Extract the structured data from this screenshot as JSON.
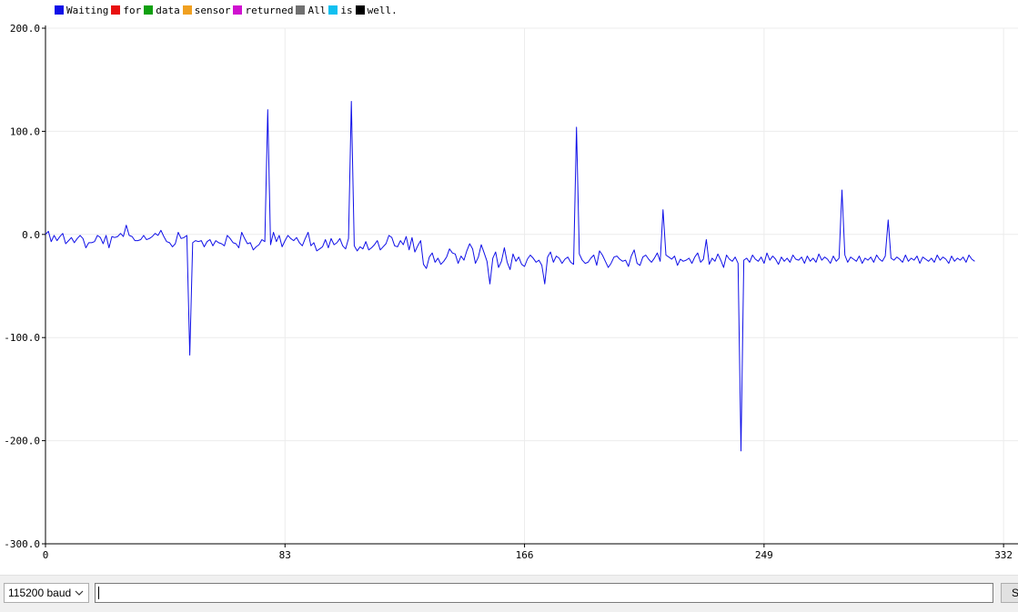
{
  "legend": [
    {
      "label": "Waiting",
      "color": "#1010e8"
    },
    {
      "label": "for",
      "color": "#e81010"
    },
    {
      "label": "data",
      "color": "#10a010"
    },
    {
      "label": "sensor",
      "color": "#f0a020"
    },
    {
      "label": "returned",
      "color": "#d010d0"
    },
    {
      "label": "All",
      "color": "#707070"
    },
    {
      "label": "is",
      "color": "#10c0f0"
    },
    {
      "label": "well.",
      "color": "#000000"
    }
  ],
  "chart_data": {
    "type": "line",
    "ylim": [
      -300,
      200
    ],
    "xlim": [
      0,
      337
    ],
    "yticks": [
      "200.0",
      "100.0",
      "0.0",
      "-100.0",
      "-200.0",
      "-300.0"
    ],
    "xticks": [
      "0",
      "83",
      "166",
      "249",
      "332"
    ],
    "grid": true,
    "series": [
      {
        "color": "#1010e8",
        "values": [
          0,
          3,
          -7,
          -1,
          -6,
          -2,
          1,
          -9,
          -6,
          -3,
          -8,
          -4,
          -1,
          -4,
          -13,
          -8,
          -8,
          -7,
          -1,
          -3,
          -9,
          -1,
          -13,
          -2,
          -3,
          -2,
          1,
          -2,
          9,
          -1,
          -2,
          -6,
          -6,
          -5,
          -1,
          -5,
          -4,
          -2,
          1,
          -1,
          4,
          -2,
          -7,
          -8,
          -12,
          -9,
          2,
          -4,
          -3,
          -1,
          -117,
          -8,
          -6,
          -7,
          -6,
          -12,
          -7,
          -5,
          -11,
          -6,
          -8,
          -9,
          -11,
          -1,
          -4,
          -8,
          -9,
          -13,
          2,
          -4,
          -9,
          -8,
          -15,
          -12,
          -10,
          -5,
          -7,
          -4,
          -10,
          2,
          -7,
          -1,
          -12,
          -6,
          -1,
          -4,
          -6,
          -3,
          -8,
          -11,
          -4,
          2,
          -11,
          -8,
          -16,
          -14,
          -12,
          -5,
          -13,
          -4,
          -10,
          -8,
          -4,
          -11,
          -14,
          -4,
          -9,
          -11,
          -16,
          -12,
          -14,
          -7,
          -15,
          -13,
          -10,
          -6,
          -15,
          -12,
          -9,
          -1,
          -3,
          -11,
          -12,
          -6,
          -10,
          -2,
          -15,
          -3,
          -17,
          -11,
          -6,
          -29,
          -33,
          -22,
          -18,
          -27,
          -23,
          -29,
          -26,
          -22,
          -14,
          -18,
          -19,
          -28,
          -21,
          -25,
          -16,
          -9,
          -14,
          -28,
          -22,
          -10,
          -18,
          -26,
          -20,
          -23,
          -17,
          -32,
          -26,
          -13,
          -27,
          -34,
          -19,
          -26,
          -22,
          -29,
          -31,
          -24,
          -20,
          -23,
          -27,
          -25,
          -30,
          -48,
          -22,
          -17,
          -27,
          -21,
          -23,
          -28,
          -24,
          -22,
          -27,
          -29,
          -26,
          -19,
          -25,
          -28,
          -27,
          -23,
          -20,
          -30,
          -16,
          -20,
          -26,
          -32,
          -28,
          -22,
          -21,
          -24,
          -26,
          -25,
          -31,
          -21,
          -15,
          -28,
          -30,
          -22,
          -20,
          -24,
          -27,
          -23,
          -18,
          -26,
          -27,
          -20,
          -22,
          -24,
          -21,
          -30,
          -24,
          -26,
          -25,
          -23,
          -28,
          -22,
          -18,
          -27,
          -24,
          -21,
          -29,
          -23,
          -26,
          -19,
          -25,
          -32,
          -20,
          -24,
          -26,
          -22,
          -28,
          -21,
          -25,
          -23,
          -27,
          -20,
          -24,
          -26,
          -22,
          -28,
          -18,
          -25,
          -21,
          -24,
          -29,
          -22,
          -26,
          -23,
          -27,
          -20,
          -24,
          -25,
          -22,
          -28,
          -21,
          -26,
          -23,
          -27,
          -19,
          -25,
          -22,
          -24,
          -28,
          -21,
          -26,
          -23,
          -25,
          -20,
          -27,
          -22,
          -24,
          -26,
          -21,
          -28,
          -23,
          -25,
          -22,
          -27,
          -20,
          -24,
          -26,
          -21,
          -28,
          -23,
          -25,
          -22,
          -24,
          -27,
          -20,
          -26,
          -23,
          -25,
          -21,
          -28,
          -22,
          -24,
          -26,
          -23,
          -27,
          -20,
          -25,
          -22,
          -24,
          -28,
          -21,
          -26,
          -23,
          -25,
          -22,
          -27,
          -20,
          -24,
          -26
        ],
        "spikes": [
          [
            77,
            121
          ],
          [
            106,
            129
          ],
          [
            154,
            -48
          ],
          [
            184,
            104
          ],
          [
            214,
            24
          ],
          [
            229,
            -5
          ],
          [
            241,
            -210
          ],
          [
            276,
            43
          ],
          [
            292,
            14
          ]
        ]
      }
    ]
  },
  "bottom_bar": {
    "baud": "115200 baud",
    "input_value": "",
    "send_label": "Send"
  }
}
